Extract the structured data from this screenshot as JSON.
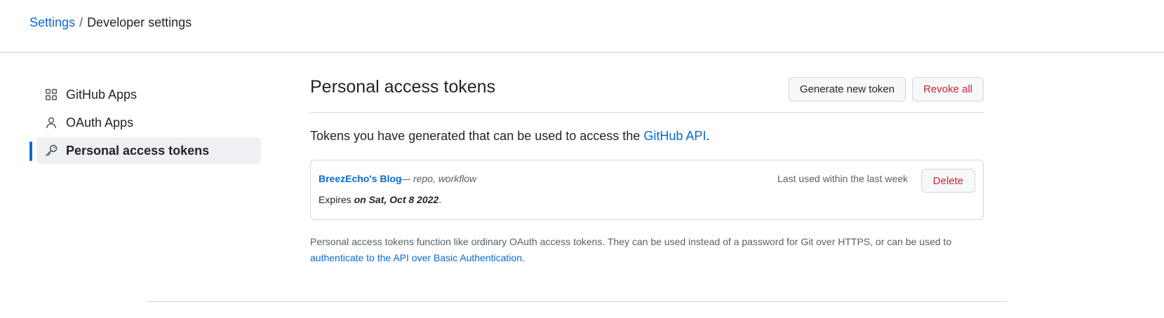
{
  "breadcrumb": {
    "root": "Settings",
    "separator": "/",
    "current": "Developer settings"
  },
  "sidebar": {
    "items": [
      {
        "label": "GitHub Apps",
        "icon": "apps-grid-icon"
      },
      {
        "label": "OAuth Apps",
        "icon": "person-icon"
      },
      {
        "label": "Personal access tokens",
        "icon": "key-icon",
        "active": true
      }
    ]
  },
  "main": {
    "title": "Personal access tokens",
    "generate_label": "Generate new token",
    "revoke_label": "Revoke all",
    "intro_text": "Tokens you have generated that can be used to access the ",
    "intro_link": "GitHub API",
    "intro_end": ".",
    "tokens": [
      {
        "name": "BreezEcho's Blog",
        "scopes": "— repo, workflow",
        "expires_prefix": "Expires ",
        "expires_date": "on Sat, Oct 8 2022",
        "expires_suffix": ".",
        "last_used": "Last used within the last week",
        "delete_label": "Delete"
      }
    ],
    "footnote_text": "Personal access tokens function like ordinary OAuth access tokens. They can be used instead of a password for Git over HTTPS, or can be used to ",
    "footnote_link": "authenticate to the API over Basic Authentication",
    "footnote_end": "."
  },
  "colors": {
    "link": "#0969da",
    "danger": "#cf222e",
    "border": "#d0d7de",
    "active_bg": "#eef0f3"
  }
}
